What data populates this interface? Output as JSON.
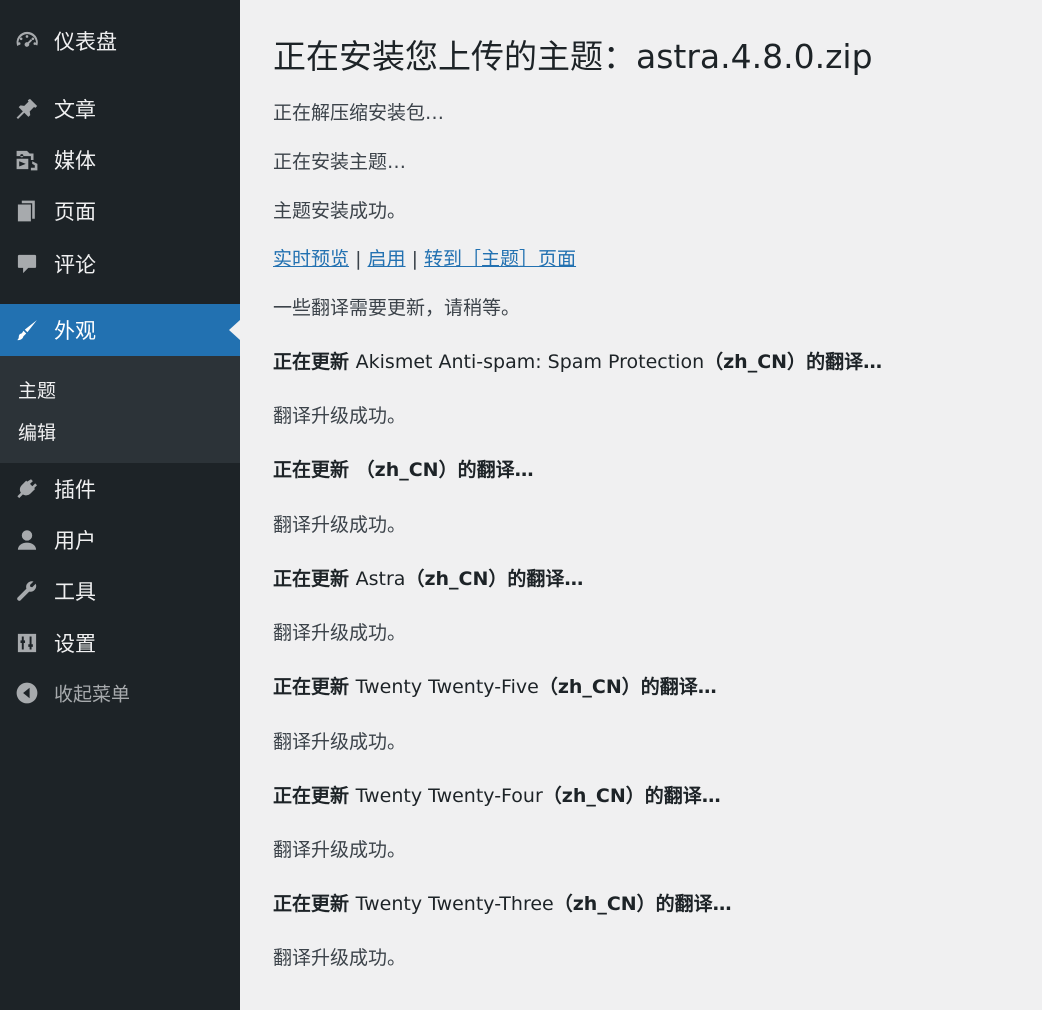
{
  "sidebar": {
    "items": [
      {
        "label": "仪表盘",
        "icon": "dashboard-icon"
      },
      {
        "label": "文章",
        "icon": "pin-icon"
      },
      {
        "label": "媒体",
        "icon": "media-icon"
      },
      {
        "label": "页面",
        "icon": "page-icon"
      },
      {
        "label": "评论",
        "icon": "comment-icon"
      },
      {
        "label": "外观",
        "icon": "paintbrush-icon"
      },
      {
        "label": "插件",
        "icon": "plugin-icon"
      },
      {
        "label": "用户",
        "icon": "user-icon"
      },
      {
        "label": "工具",
        "icon": "wrench-icon"
      },
      {
        "label": "设置",
        "icon": "settings-icon"
      }
    ],
    "submenu": [
      "主题",
      "编辑"
    ],
    "collapse_label": "收起菜单",
    "active_color": "#2271b1"
  },
  "main": {
    "title": "正在安装您上传的主题：astra.4.8.0.zip",
    "steps": [
      "正在解压缩安装包…",
      "正在安装主题…",
      "主题安装成功。"
    ],
    "links": {
      "preview": "实时预览",
      "activate": "启用",
      "goto": "转到［主题］页面",
      "separator": "|"
    },
    "translation_notice": "一些翻译需要更新，请稍等。",
    "updates": [
      {
        "prefix": "正在更新",
        "name": "Akismet Anti-spam: Spam Protection",
        "locale": "（zh_CN）",
        "suffix": "的翻译…",
        "result": "翻译升级成功。"
      },
      {
        "prefix": "正在更新",
        "name": "",
        "locale": "（zh_CN）",
        "suffix": "的翻译…",
        "result": "翻译升级成功。"
      },
      {
        "prefix": "正在更新",
        "name": "Astra",
        "locale": "（zh_CN）",
        "suffix": "的翻译…",
        "result": "翻译升级成功。"
      },
      {
        "prefix": "正在更新",
        "name": "Twenty Twenty-Five",
        "locale": "（zh_CN）",
        "suffix": "的翻译…",
        "result": "翻译升级成功。"
      },
      {
        "prefix": "正在更新",
        "name": "Twenty Twenty-Four",
        "locale": "（zh_CN）",
        "suffix": "的翻译…",
        "result": "翻译升级成功。"
      },
      {
        "prefix": "正在更新",
        "name": "Twenty Twenty-Three",
        "locale": "（zh_CN）",
        "suffix": "的翻译…",
        "result": "翻译升级成功。"
      }
    ]
  }
}
